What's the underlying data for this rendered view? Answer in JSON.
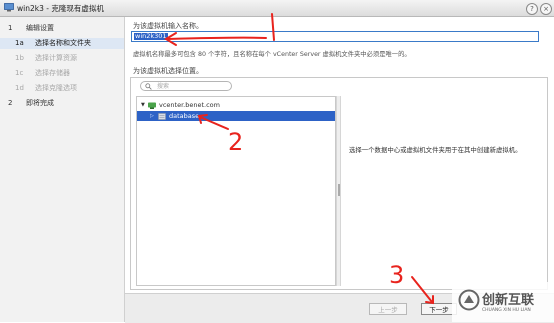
{
  "window": {
    "title": "win2k3 - 克隆现有虚拟机",
    "help_icon": "help-icon",
    "close_icon": "close-icon"
  },
  "steps": [
    {
      "num": "1",
      "label": "编辑设置",
      "level": "main",
      "active": false
    },
    {
      "num": "1a",
      "label": "选择名称和文件夹",
      "level": "sub",
      "active": true
    },
    {
      "num": "1b",
      "label": "选择计算资源",
      "level": "sub",
      "active": false
    },
    {
      "num": "1c",
      "label": "选择存储器",
      "level": "sub",
      "active": false
    },
    {
      "num": "1d",
      "label": "选择克隆选项",
      "level": "sub",
      "active": false
    },
    {
      "num": "2",
      "label": "即将完成",
      "level": "main",
      "active": false
    }
  ],
  "name_section": {
    "label": "为该虚拟机输入名称。",
    "value": "win2k301",
    "hint": "虚拟机名称最多可包含 80 个字符，且名称在每个 vCenter Server 虚拟机文件夹中必须是唯一的。"
  },
  "location_section": {
    "label": "为该虚拟机选择位置。",
    "search_placeholder": "搜索",
    "tree": [
      {
        "label": "vcenter.benet.com",
        "icon": "vcenter-icon",
        "expanded": true,
        "selected": false
      },
      {
        "label": "database",
        "icon": "datacenter-icon",
        "expanded": false,
        "selected": true
      }
    ],
    "info": "选择一个数据中心或虚拟机文件夹用于在其中创建新虚拟机。"
  },
  "footer": {
    "back_label": "上一步",
    "next_label": "下一步"
  },
  "annotations": {
    "mark_2": "2",
    "mark_3": "3",
    "color": "#e8231d"
  },
  "watermark": {
    "text": "创新互联",
    "sub": "CHUANG XIN HU LIAN"
  }
}
